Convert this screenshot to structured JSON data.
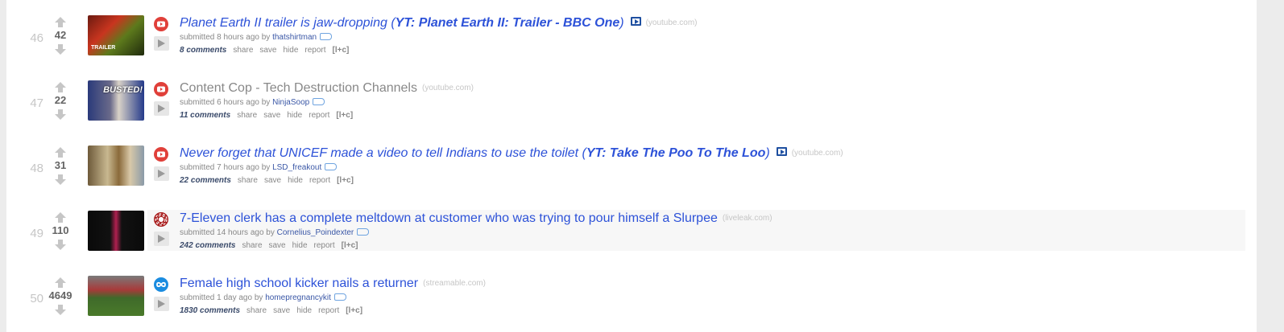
{
  "posts": [
    {
      "rank": "46",
      "score": "42",
      "site": "youtube",
      "title_segments": [
        {
          "text": "Planet Earth II trailer is jaw-dropping (",
          "blue": true,
          "italic": true,
          "bold": false
        },
        {
          "text": "YT: Planet Earth II: Trailer - BBC One",
          "blue": true,
          "italic": true,
          "bold": true
        },
        {
          "text": ")",
          "blue": true,
          "italic": true,
          "bold": false
        }
      ],
      "has_video_icon": true,
      "domain": "(youtube.com)",
      "submitted": "submitted 8 hours ago by",
      "author": "thatshirtman",
      "comments": "8 comments",
      "thumb_caption": "TRAILER"
    },
    {
      "rank": "47",
      "score": "22",
      "site": "youtube",
      "title_segments": [
        {
          "text": "Content Cop - Tech Destruction Channels",
          "blue": false,
          "italic": false,
          "bold": false
        }
      ],
      "has_video_icon": false,
      "domain": "(youtube.com)",
      "submitted": "submitted 6 hours ago by",
      "author": "NinjaSoop",
      "comments": "11 comments",
      "thumb_caption": "BUSTED!"
    },
    {
      "rank": "48",
      "score": "31",
      "site": "youtube",
      "title_segments": [
        {
          "text": "Never forget that UNICEF made a video to tell Indians to use the toilet (",
          "blue": true,
          "italic": true,
          "bold": false
        },
        {
          "text": "YT: Take The Poo To The Loo",
          "blue": true,
          "italic": true,
          "bold": true
        },
        {
          "text": ")",
          "blue": true,
          "italic": true,
          "bold": false
        }
      ],
      "has_video_icon": true,
      "domain": "(youtube.com)",
      "submitted": "submitted 7 hours ago by",
      "author": "LSD_freakout",
      "comments": "22 comments",
      "thumb_caption": ""
    },
    {
      "rank": "49",
      "score": "110",
      "site": "liveleak",
      "title_segments": [
        {
          "text": "7-Eleven clerk has a complete meltdown at customer who was trying to pour himself a Slurpee",
          "blue": true,
          "italic": false,
          "bold": false
        }
      ],
      "has_video_icon": false,
      "domain": "(liveleak.com)",
      "submitted": "submitted 14 hours ago by",
      "author": "Cornelius_Poindexter",
      "comments": "242 comments",
      "thumb_caption": ""
    },
    {
      "rank": "50",
      "score": "4649",
      "site": "streamable",
      "title_segments": [
        {
          "text": "Female high school kicker nails a returner",
          "blue": true,
          "italic": false,
          "bold": false
        }
      ],
      "has_video_icon": false,
      "domain": "(streamable.com)",
      "submitted": "submitted 1 day ago by",
      "author": "homepregnancykit",
      "comments": "1830 comments",
      "thumb_caption": ""
    }
  ],
  "action_labels": {
    "share": "share",
    "save": "save",
    "hide": "hide",
    "report": "report",
    "lc": "[l+c]"
  },
  "colors": {
    "youtube": "#e0403a",
    "liveleak": "#a81b1b",
    "streamable": "#1a8ce0",
    "link_blue": "#2d52d8",
    "visited_gray": "#888888"
  }
}
